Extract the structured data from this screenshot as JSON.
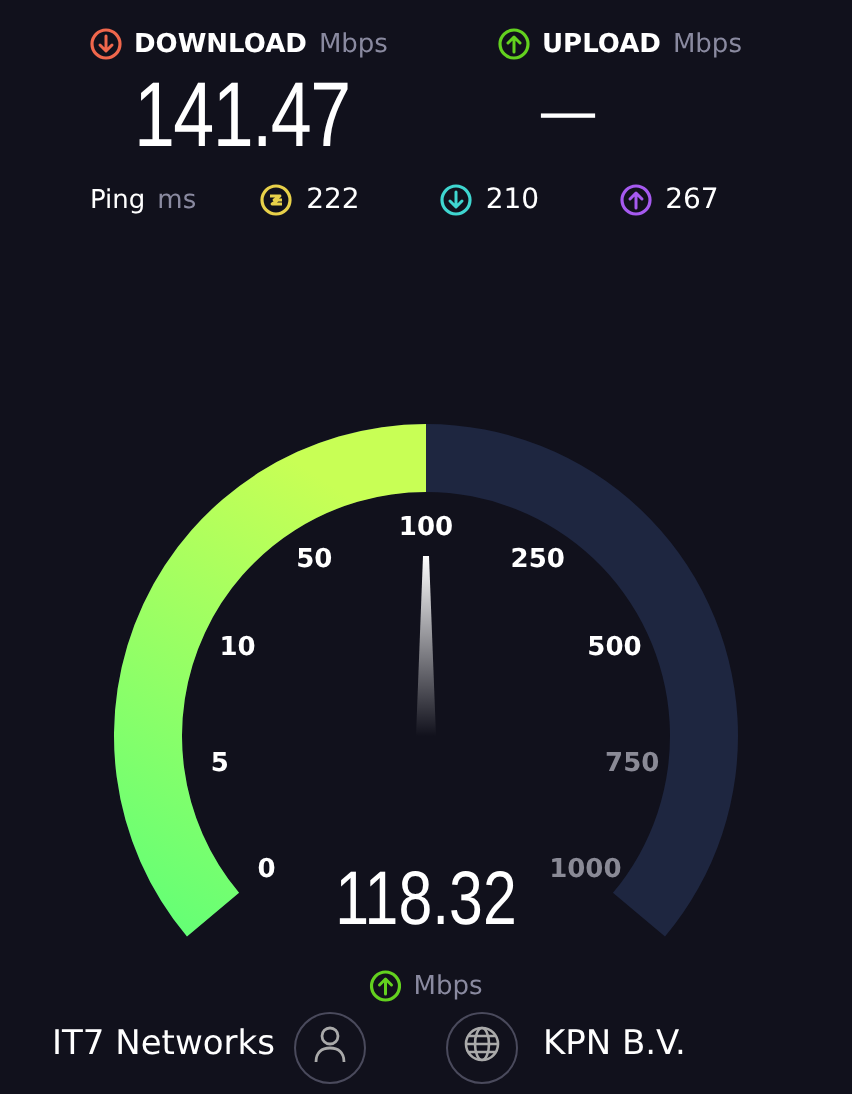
{
  "download": {
    "label": "DOWNLOAD",
    "unit": "Mbps",
    "value": "141.47"
  },
  "upload": {
    "label": "UPLOAD",
    "unit": "Mbps",
    "value": "—"
  },
  "ping": {
    "label": "Ping",
    "unit": "ms",
    "readings": [
      {
        "kind": "idle",
        "value": "222",
        "color": "#e8d14a"
      },
      {
        "kind": "down",
        "value": "210",
        "color": "#3fd6d0"
      },
      {
        "kind": "up",
        "value": "267",
        "color": "#a65af0"
      }
    ]
  },
  "gauge": {
    "ticks": [
      {
        "label": "0",
        "reached": true
      },
      {
        "label": "5",
        "reached": true
      },
      {
        "label": "10",
        "reached": true
      },
      {
        "label": "50",
        "reached": true
      },
      {
        "label": "100",
        "reached": true
      },
      {
        "label": "250",
        "reached": true
      },
      {
        "label": "500",
        "reached": true
      },
      {
        "label": "750",
        "reached": false
      },
      {
        "label": "1000",
        "reached": false
      }
    ],
    "reading": "118.32",
    "unit": "Mbps"
  },
  "servers": [
    {
      "kind": "isp",
      "name": "IT7 Networks"
    },
    {
      "kind": "host",
      "name": "KPN B.V."
    }
  ]
}
